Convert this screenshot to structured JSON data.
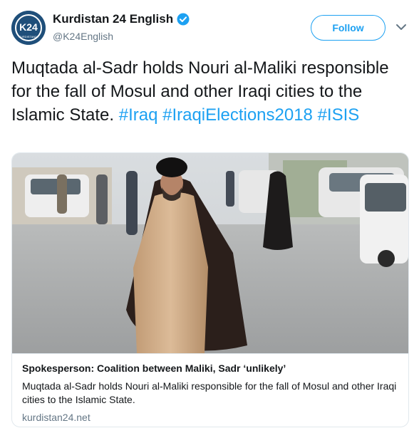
{
  "account": {
    "name": "Kurdistan 24 English",
    "handle": "@K24English",
    "avatar_logo_text": "K24",
    "avatar_sub_text": "KURDISTAN24",
    "verified_icon": "verified-badge-icon"
  },
  "actions": {
    "follow_label": "Follow",
    "menu_icon": "chevron-down-icon"
  },
  "tweet": {
    "text_plain": "Muqtada al-Sadr holds Nouri al-Maliki responsible for the fall of Mosul and other Iraqi cities to the Islamic State.",
    "hashtags": [
      "#Iraq",
      "#IraqiElections2018",
      "#ISIS"
    ]
  },
  "card": {
    "image_alt": "Muqtada al-Sadr walking down a street",
    "title": "Spokesperson: Coalition between Maliki, Sadr ‘unlikely’",
    "description": "Muqtada al-Sadr holds Nouri al-Maliki responsible for the fall of Mosul and other Iraqi cities to the Islamic State.",
    "domain": "kurdistan24.net"
  },
  "colors": {
    "accent": "#1da1f2",
    "text": "#14171a",
    "muted": "#657786",
    "border": "#e1e8ed"
  }
}
